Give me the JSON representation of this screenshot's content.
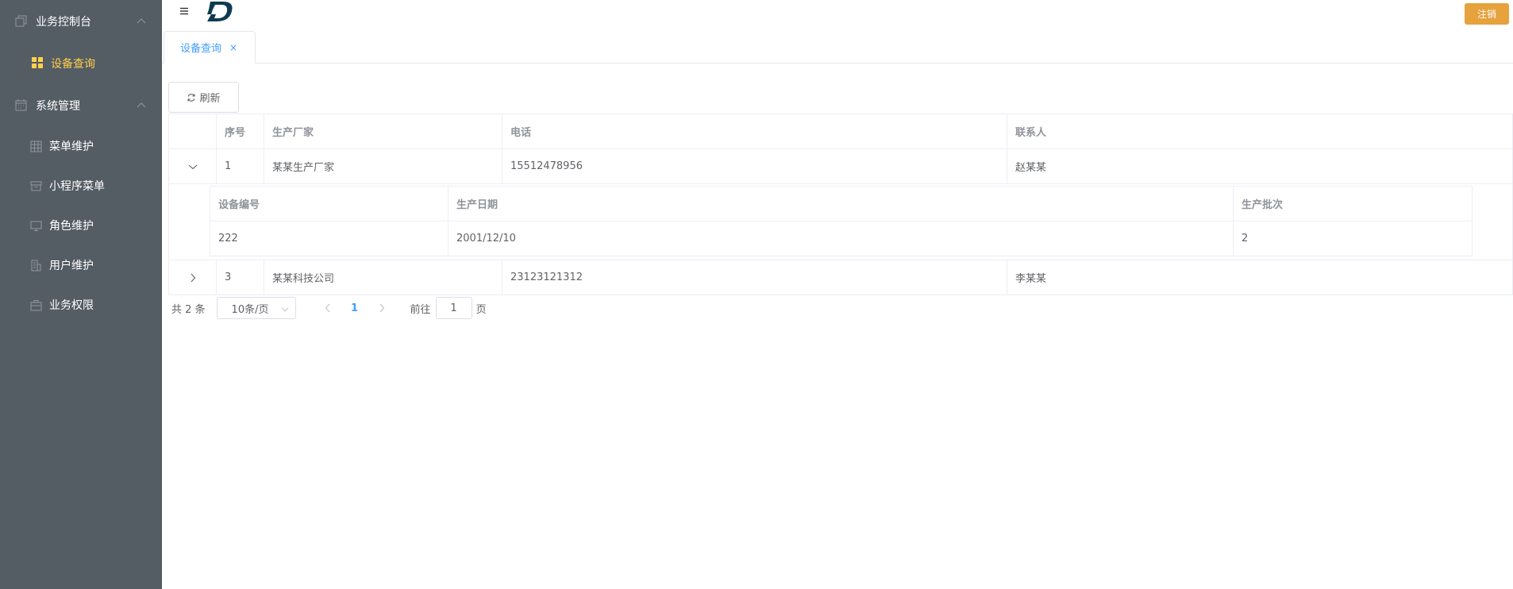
{
  "sidebar": {
    "groups": [
      {
        "label": "业务控制台",
        "icon": "copy-icon",
        "items": [
          {
            "label": "设备查询",
            "icon": "grid-icon",
            "active": true
          }
        ]
      },
      {
        "label": "系统管理",
        "icon": "calendar-icon",
        "items": [
          {
            "label": "菜单维护",
            "icon": "table-icon"
          },
          {
            "label": "小程序菜单",
            "icon": "box-icon"
          },
          {
            "label": "角色维护",
            "icon": "monitor-icon"
          },
          {
            "label": "用户维护",
            "icon": "building-icon"
          },
          {
            "label": "业务权限",
            "icon": "suitcase-icon"
          }
        ]
      }
    ]
  },
  "header": {
    "logo_text": "D",
    "logout_label": "注销"
  },
  "tabs": [
    {
      "label": "设备查询",
      "close": "×",
      "active": true
    }
  ],
  "toolbar": {
    "refresh_label": "刷新"
  },
  "table": {
    "columns": [
      "序号",
      "生产厂家",
      "电话",
      "联系人"
    ],
    "rows": [
      {
        "index": "1",
        "manufacturer": "某某生产厂家",
        "phone": "15512478956",
        "contact": "赵某某",
        "expanded": true
      },
      {
        "index": "3",
        "manufacturer": "某某科技公司",
        "phone": "23123121312",
        "contact": "李某某",
        "expanded": false
      }
    ],
    "subtable": {
      "columns": [
        "设备编号",
        "生产日期",
        "生产批次"
      ],
      "rows": [
        {
          "code": "222",
          "date": "2001/12/10",
          "batch": "2"
        }
      ]
    }
  },
  "pagination": {
    "total_text": "共 2 条",
    "page_size": "10条/页",
    "current_page": "1",
    "goto_label": "前往",
    "goto_value": "1",
    "page_suffix": "页"
  },
  "colors": {
    "sidebar_bg": "#545c64",
    "active_menu": "#ffd04b",
    "primary": "#409eff",
    "warning": "#e6a23c"
  }
}
